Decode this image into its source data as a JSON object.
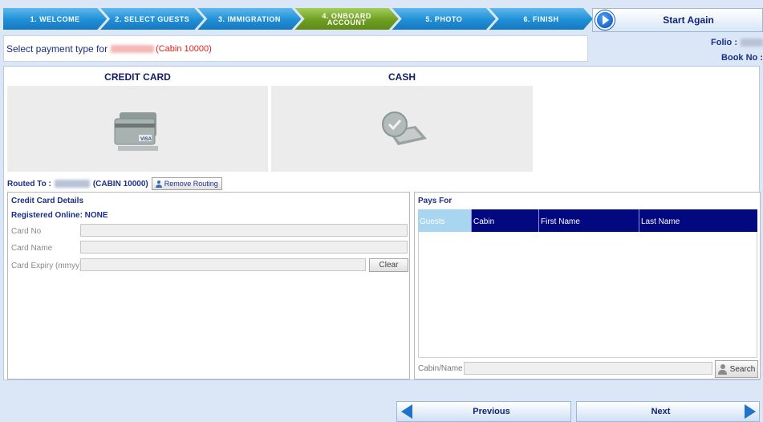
{
  "wizard": {
    "steps": [
      {
        "label": "1. Welcome"
      },
      {
        "label": "2. Select Guests"
      },
      {
        "label": "3. Immigration"
      },
      {
        "label": "4. Onboard Account"
      },
      {
        "label": "5. Photo"
      },
      {
        "label": "6. Finish"
      }
    ],
    "active_step": 3
  },
  "start_again": {
    "label": "Start Again"
  },
  "header": {
    "prefix": "Select payment type for",
    "cabin": "(Cabin 10000)"
  },
  "folio": {
    "folio_label": "Folio :",
    "book_label": "Book No :"
  },
  "payment_types": {
    "credit_card": {
      "label": "CREDIT CARD"
    },
    "cash": {
      "label": "CASH"
    }
  },
  "routing": {
    "label": "Routed To :",
    "cabin": "(CABIN 10000)",
    "remove_label": "Remove Routing"
  },
  "credit_card_details": {
    "title": "Credit Card Details",
    "registered": "Registered Online: NONE",
    "card_no_label": "Card No",
    "card_no_value": "",
    "card_name_label": "Card Name",
    "card_name_value": "",
    "card_expiry_label": "Card Expiry (mmyy)",
    "card_expiry_value": "",
    "clear_label": "Clear"
  },
  "pays_for": {
    "title": "Pays For",
    "columns": [
      "Guests",
      "Cabin",
      "First Name",
      "Last Name"
    ],
    "rows": [],
    "search_label": "Cabin/Name",
    "search_value": "",
    "search_button": "Search"
  },
  "nav": {
    "previous": "Previous",
    "next": "Next"
  },
  "colors": {
    "wizard_blue": "#1f8fd6",
    "wizard_active": "#6f9e22",
    "grid_header": "#020980",
    "accent_red": "#e31b1b"
  }
}
